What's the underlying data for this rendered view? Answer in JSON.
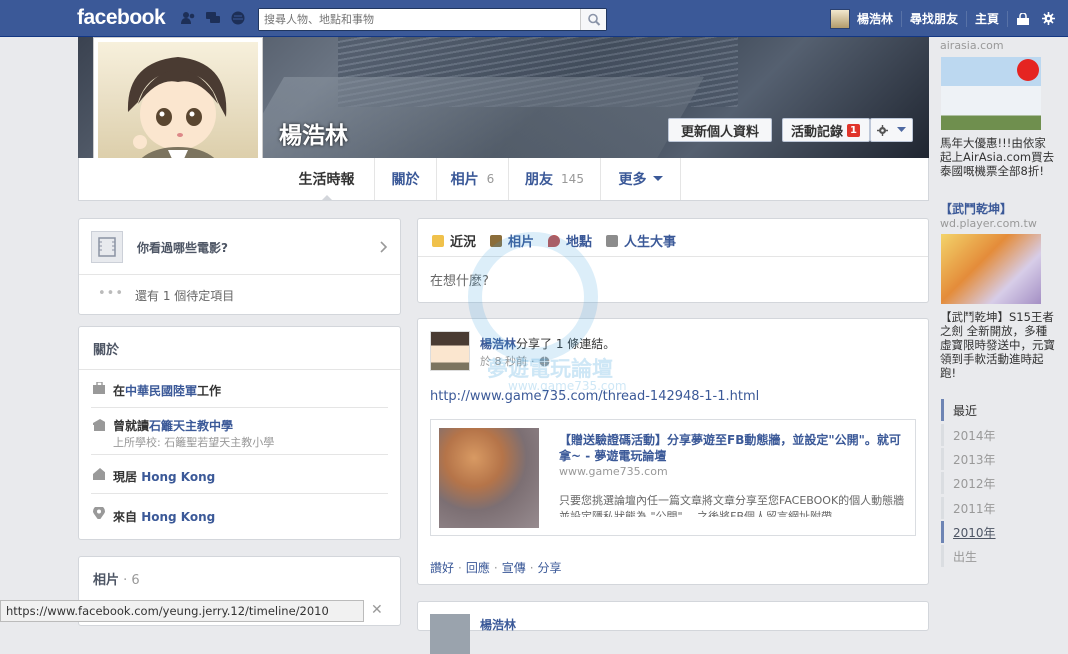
{
  "topbar": {
    "logo": "facebook",
    "search_placeholder": "搜尋人物、地點和事物",
    "user_name": "楊浩林",
    "find_friends": "尋找朋友",
    "home": "主頁"
  },
  "profile": {
    "name": "楊浩林",
    "update_info": "更新個人資料",
    "activity_log": "活動記錄",
    "activity_count": "1",
    "tabs": [
      {
        "label": "生活時報",
        "count": ""
      },
      {
        "label": "關於",
        "count": ""
      },
      {
        "label": "相片",
        "count": "6"
      },
      {
        "label": "朋友",
        "count": "145"
      },
      {
        "label": "更多",
        "count": ""
      }
    ]
  },
  "left": {
    "movies_prompt": "你看過哪些電影?",
    "pending": "還有 1 個待定項目",
    "about_title": "關於",
    "about": [
      {
        "pre": "在",
        "link": "中華民國陸軍",
        "post": "工作",
        "sub": ""
      },
      {
        "pre": "曾就讀",
        "link": "石籬天主教中學",
        "post": "",
        "sub": "上所學校: 石籬聖若望天主教小學"
      },
      {
        "pre": "現居 ",
        "link": "Hong Kong",
        "post": "",
        "sub": ""
      },
      {
        "pre": "來自 ",
        "link": "Hong Kong",
        "post": "",
        "sub": ""
      }
    ],
    "photos_title": "相片",
    "photos_count": "6"
  },
  "composer": {
    "tabs": [
      "近況",
      "相片",
      "地點",
      "人生大事"
    ],
    "placeholder": "在想什麼?"
  },
  "post": {
    "author": "楊浩林",
    "action": "分享了 1 條連結。",
    "time": "於 8 秒前",
    "link_text": "http://www.game735.com/thread-142948-1-1.html",
    "preview_title": "【贈送驗證碼活動】分享夢遊至FB動態牆，並設定\"公開\"。就可拿~ - 夢遊電玩論壇",
    "preview_domain": "www.game735.com",
    "preview_desc": "只要您挑選論壇內任一篇文章將文章分享至您FACEBOOK的個人動態牆並設定隱私狀態為 \"公開\" 。之後將FB個人留言網址附帶",
    "actions": [
      "讚好",
      "回應",
      "宣傳",
      "分享"
    ],
    "next_author": "楊浩林"
  },
  "ads": [
    {
      "title": "",
      "url": "airasia.com",
      "body": "馬年大優惠!!!由依家起上AirAsia.com買去泰國嘅機票全部8折!"
    },
    {
      "title": "【武鬥乾坤】",
      "url": "wd.player.com.tw",
      "body": "【武鬥乾坤】S15王者之劍 全新開放，多種虛寶限時發送中，元寶領到手軟活動進時起跑!"
    }
  ],
  "years": [
    "最近",
    "2014年",
    "2013年",
    "2012年",
    "2011年",
    "2010年",
    "出生"
  ],
  "status_url": "https://www.facebook.com/yeung.jerry.12/timeline/2010",
  "watermark_text": "夢遊電玩論壇",
  "watermark_url": "www.game735.com"
}
